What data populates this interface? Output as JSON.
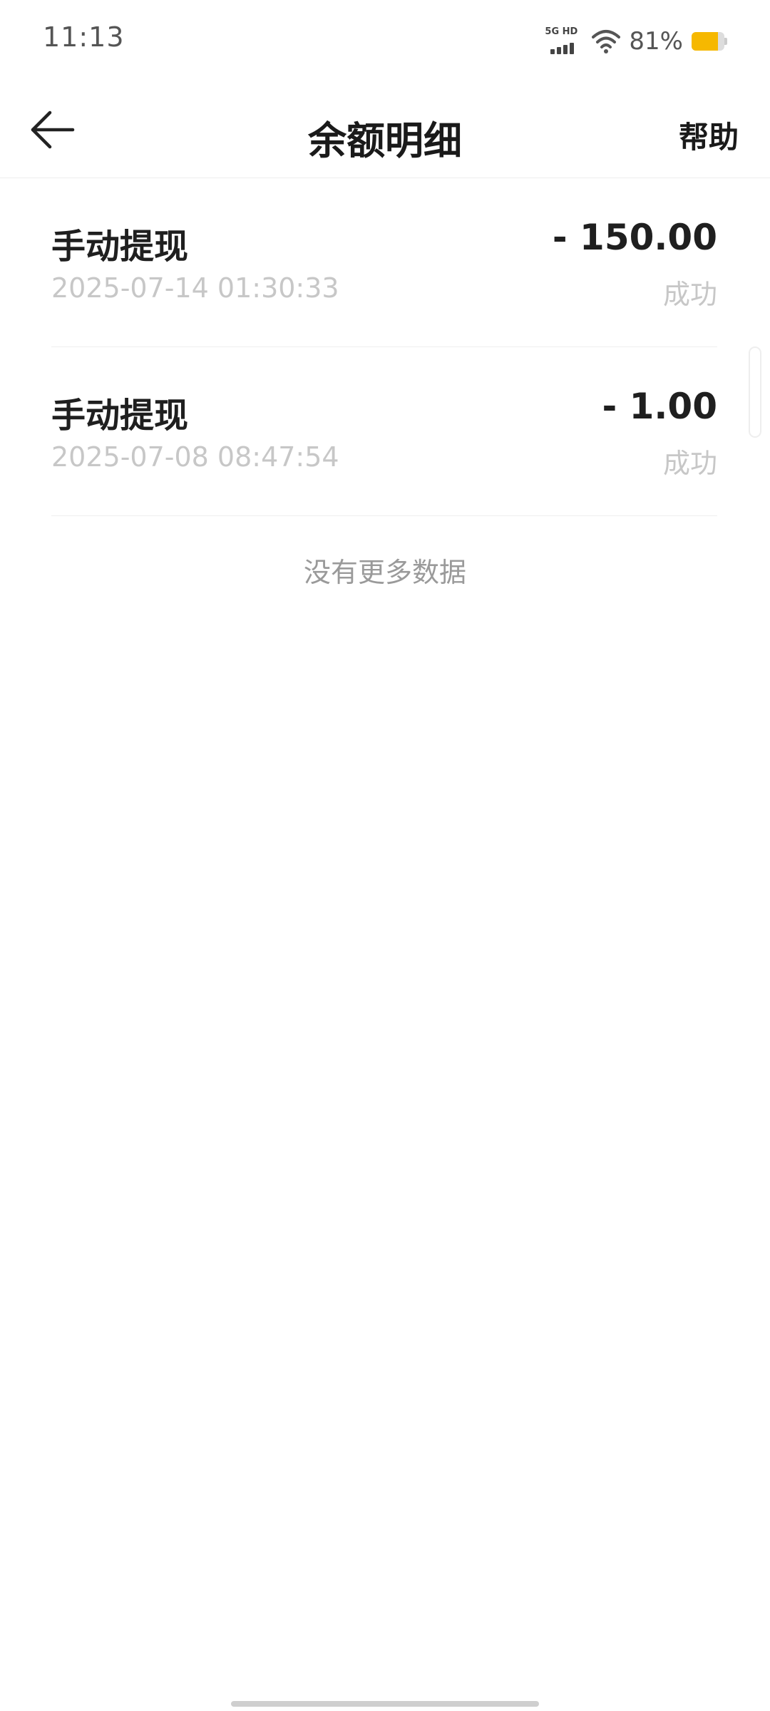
{
  "status_bar": {
    "time": "11:13",
    "network_label": "5G HD",
    "battery_percent": "81%",
    "battery_level": 0.81,
    "battery_color": "#f6b800"
  },
  "nav": {
    "back_icon": "arrow-left-icon",
    "title": "余额明细",
    "help_label": "帮助"
  },
  "records": [
    {
      "title": "手动提现",
      "time": "2025-07-14 01:30:33",
      "amount": "- 150.00",
      "status": "成功"
    },
    {
      "title": "手动提现",
      "time": "2025-07-08 08:47:54",
      "amount": "- 1.00",
      "status": "成功"
    }
  ],
  "footer": {
    "no_more_text": "没有更多数据"
  }
}
